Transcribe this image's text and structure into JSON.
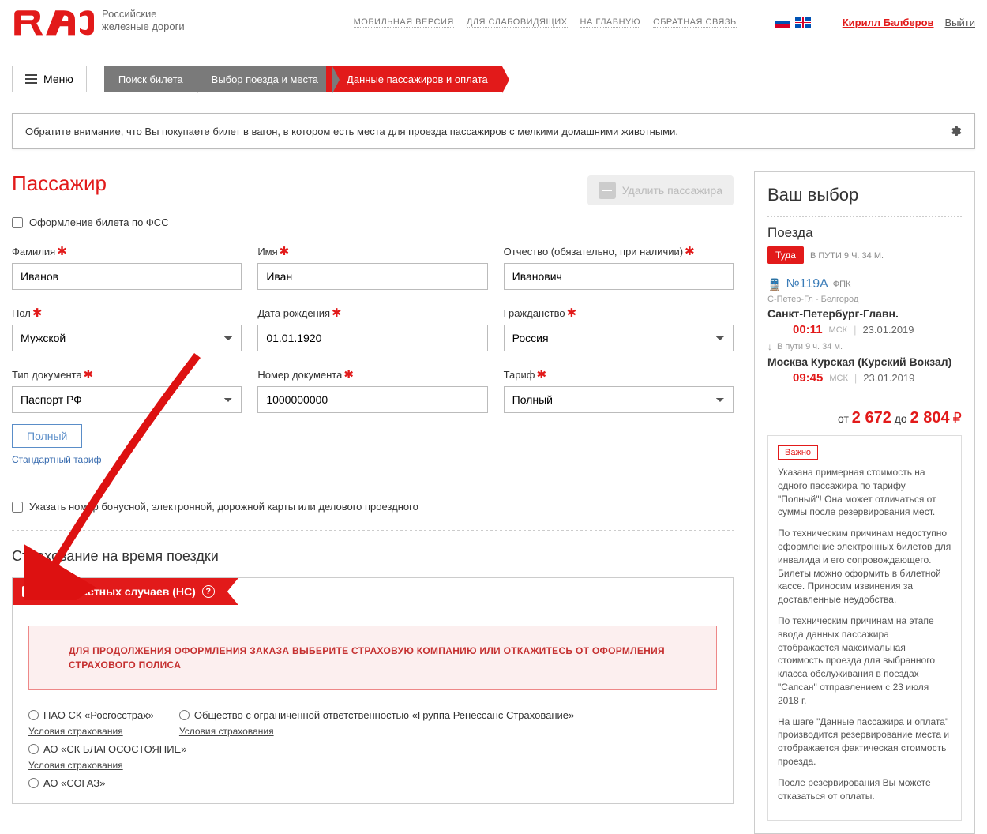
{
  "header": {
    "brand_line1": "Российские",
    "brand_line2": "железные дороги",
    "links": {
      "mobile": "МОБИЛЬНАЯ ВЕРСИЯ",
      "accessibility": "ДЛЯ СЛАБОВИДЯЩИХ",
      "home": "НА ГЛАВНУЮ",
      "feedback": "ОБРАТНАЯ СВЯЗЬ"
    },
    "user_name": "Кирилл Балберов",
    "logout": "Выйти",
    "menu": "Меню"
  },
  "breadcrumb": {
    "b1": "Поиск билета",
    "b2": "Выбор поезда и места",
    "b3": "Данные пассажиров и оплата"
  },
  "notice": "Обратите внимание, что Вы покупаете билет в вагон, в котором есть места для проезда пассажиров с мелкими домашними животными.",
  "passenger": {
    "title": "Пассажир",
    "delete": "Удалить пассажира",
    "fss": "Оформление билета по ФСС",
    "labels": {
      "surname": "Фамилия",
      "name": "Имя",
      "patronymic": "Отчество (обязательно, при наличии)",
      "gender": "Пол",
      "dob": "Дата рождения",
      "citizenship": "Гражданство",
      "doctype": "Тип документа",
      "docnum": "Номер документа",
      "tariff": "Тариф"
    },
    "values": {
      "surname": "Иванов",
      "name": "Иван",
      "patronymic": "Иванович",
      "gender": "Мужской",
      "dob": "01.01.1920",
      "citizenship": "Россия",
      "doctype": "Паспорт РФ",
      "docnum": "1000000000",
      "tariff": "Полный"
    },
    "tariff_btn": "Полный",
    "tariff_link": "Стандартный тариф",
    "loyalty": "Указать номер бонусной, электронной, дорожной карты или делового проездного"
  },
  "insurance": {
    "title": "Страхование на время поездки",
    "ribbon": "От несчастных случаев (НС)",
    "warning": "ДЛЯ ПРОДОЛЖЕНИЯ ОФОРМЛЕНИЯ ЗАКАЗА ВЫБЕРИТЕ СТРАХОВУЮ КОМПАНИЮ ИЛИ ОТКАЖИТЕСЬ ОТ ОФОРМЛЕНИЯ СТРАХОВОГО ПОЛИСА",
    "terms": "Условия страхования",
    "opts": {
      "o1": "ПАО СК «Росгосстрах»",
      "o2": "Общество с ограниченной ответственностью «Группа Ренессанс Страхование»",
      "o3": "АО «СК БЛАГОСОСТОЯНИЕ»",
      "o4": "АО «СОГАЗ»"
    }
  },
  "side": {
    "title": "Ваш выбор",
    "trains": "Поезда",
    "dir": "Туда",
    "dur_head": "В ПУТИ 9 Ч. 34 М.",
    "train_num": "№119А",
    "carrier": "ФПК",
    "route": "С-Петер-Гл - Белгород",
    "dep_station": "Санкт-Петербург-Главн.",
    "dep_time": "00:11",
    "msk": "МСК",
    "dep_date": "23.01.2019",
    "duration": "В пути  9 ч. 34 м.",
    "arr_station": "Москва Курская (Курский Вокзал)",
    "arr_time": "09:45",
    "arr_date": "23.01.2019",
    "from_label": "от",
    "to_label": "до",
    "price_from": "2 672",
    "price_to": "2 804",
    "important": "Важно",
    "note1": "Указана примерная стоимость на одного пассажира по тарифу \"Полный\"! Она может отличаться от суммы после резервирования мест.",
    "note2": "По техническим причинам недоступно оформление электронных билетов для инвалида и его сопровождающего. Билеты можно оформить в билетной кассе. Приносим извинения за доставленные неудобства.",
    "note3": "По техническим причинам на этапе ввода данных пассажира отображается максимальная стоимость проезда для выбранного класса обслуживания в поездах \"Сапсан\" отправлением с 23 июля 2018 г.",
    "note4": "На шаге \"Данные пассажира и оплата\" производится резервирование места и отображается фактическая стоимость проезда.",
    "note5": "После резервирования Вы можете отказаться от оплаты."
  }
}
